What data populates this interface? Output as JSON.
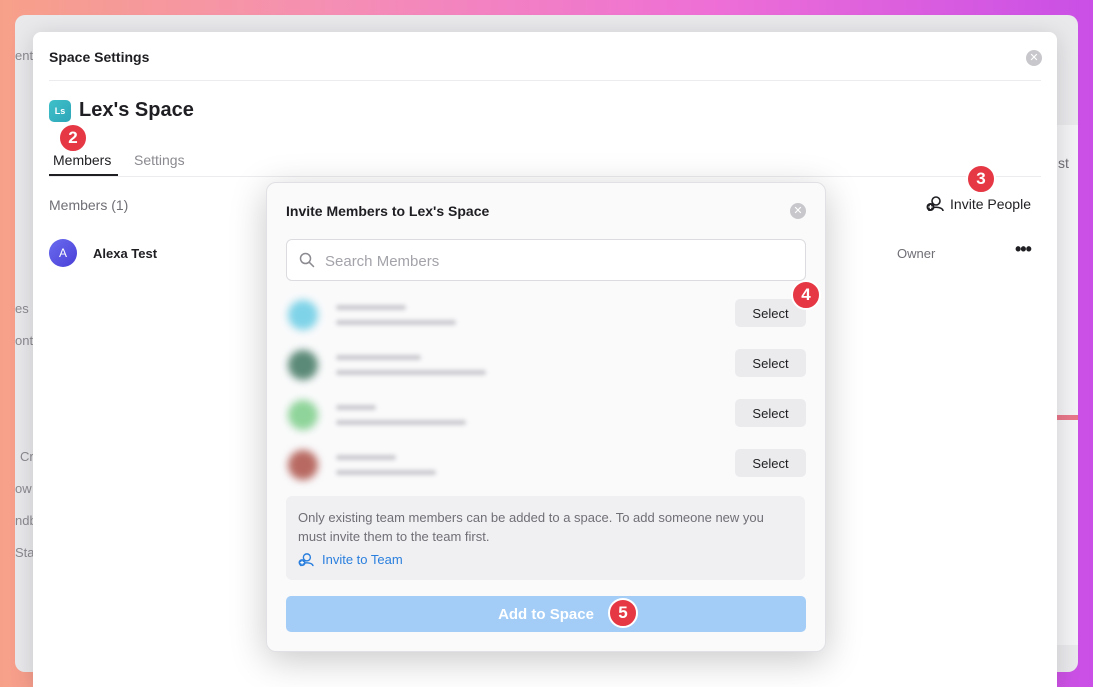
{
  "settings_modal": {
    "title": "Space Settings",
    "space_name": "Lex's Space",
    "space_logo_text": "Ls",
    "tabs": [
      {
        "label": "Members",
        "active": true
      },
      {
        "label": "Settings",
        "active": false
      }
    ],
    "members_count_label": "Members (1)",
    "invite_people_label": "Invite People",
    "members": [
      {
        "avatar_initial": "A",
        "name": "Alexa Test",
        "role": "Owner"
      }
    ]
  },
  "invite_modal": {
    "title": "Invite Members to Lex's Space",
    "search_placeholder": "Search Members",
    "select_label": "Select",
    "candidate_colors": [
      "#7fd3e8",
      "#5c8a78",
      "#8fd49a",
      "#b86a62"
    ],
    "info_text": "Only existing team members can be added to a space. To add someone new you must invite them to the team first.",
    "invite_team_label": "Invite to Team",
    "add_button_label": "Add to Space"
  },
  "step_badges": [
    "2",
    "3",
    "4",
    "5"
  ],
  "background": {
    "peek_texts": [
      "ent",
      "es",
      "ont",
      "Cr",
      "ow",
      "ndb",
      "Sta",
      "st"
    ]
  },
  "colors": {
    "badge": "#e53844",
    "link": "#2a7fde",
    "primary_disabled": "#a3cdf7"
  }
}
